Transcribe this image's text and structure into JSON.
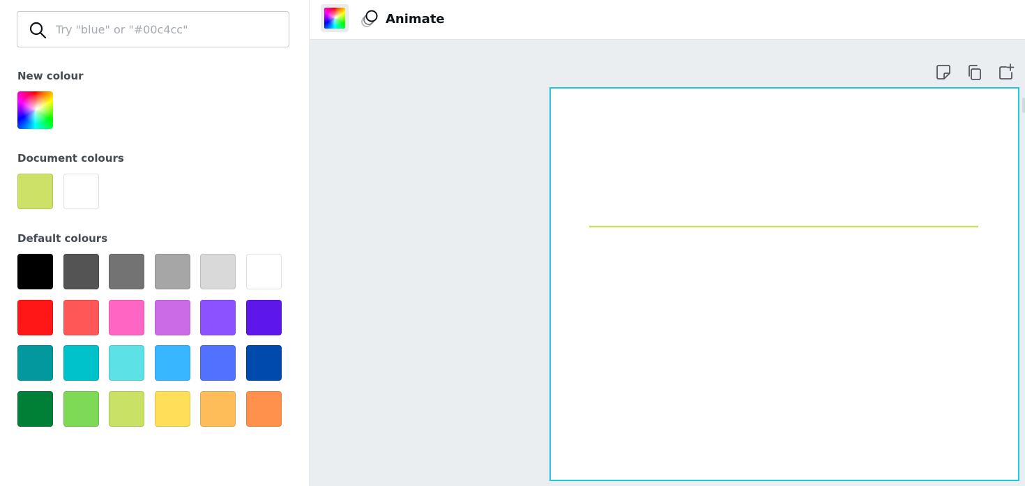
{
  "search": {
    "placeholder": "Try \"blue\" or \"#00c4cc\""
  },
  "sections": {
    "new_colour": "New colour",
    "document_colours": "Document colours",
    "default_colours": "Default colours"
  },
  "document_colours": [
    "#cce166",
    "#ffffff"
  ],
  "default_colours": [
    [
      "#000000",
      "#545454",
      "#737373",
      "#a6a6a6",
      "#d9d9d9",
      "#ffffff"
    ],
    [
      "#ff1616",
      "#ff5757",
      "#ff66c4",
      "#cb6ce6",
      "#8c52ff",
      "#5e17eb"
    ],
    [
      "#03989e",
      "#00c2cb",
      "#5ce1e6",
      "#38b6ff",
      "#5271ff",
      "#004aad"
    ],
    [
      "#008037",
      "#7ed957",
      "#c9e265",
      "#ffde59",
      "#ffbd59",
      "#ff914d"
    ]
  ],
  "toolbar": {
    "animate_label": "Animate"
  },
  "canvas": {
    "line_color": "#c9e265",
    "selection_color": "#1ec8d8"
  },
  "icons": {
    "search": "search-icon",
    "animate": "animate-icon",
    "notes": "sticky-note-icon",
    "duplicate": "duplicate-page-icon",
    "add_page": "add-page-icon"
  }
}
